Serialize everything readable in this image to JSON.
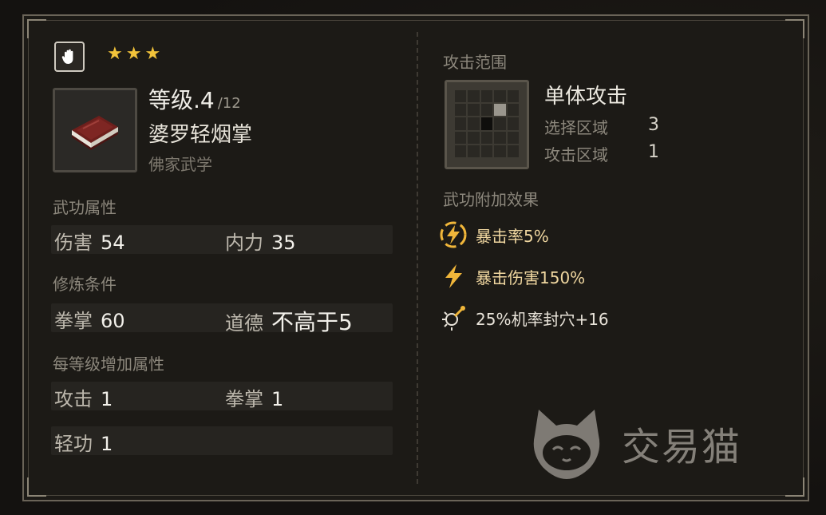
{
  "skill": {
    "stars": 3,
    "level_text": "等级.4",
    "max_level_text": "/12",
    "name": "婆罗轻烟掌",
    "school": "佛家武学"
  },
  "attributes": {
    "label": "武功属性",
    "damage_key": "伤害",
    "damage_value": "54",
    "inner_key": "内力",
    "inner_value": "35"
  },
  "requirements": {
    "label": "修炼条件",
    "fist_key": "拳掌",
    "fist_value": "60",
    "morality_key": "道德",
    "morality_value": "不高于5"
  },
  "per_level": {
    "label": "每等级增加属性",
    "attack_key": "攻击",
    "attack_value": "1",
    "fist_key": "拳掌",
    "fist_value": "1",
    "lightness_key": "轻功",
    "lightness_value": "1"
  },
  "range": {
    "label": "攻击范围",
    "type": "单体攻击",
    "select_key": "选择区域",
    "select_value": "3",
    "attack_key": "攻击区域",
    "attack_value": "1"
  },
  "effects": {
    "label": "武功附加效果",
    "items": [
      {
        "icon": "lightning-circle-icon",
        "text": "暴击率5%"
      },
      {
        "icon": "lightning-icon",
        "text": "暴击伤害150%"
      },
      {
        "icon": "acupoint-pin-icon",
        "text": "25%机率封穴+16"
      }
    ]
  },
  "watermark": "交易猫",
  "colors": {
    "star": "#f2c33a",
    "effect_text": "#f0d7a0",
    "effect_icon": "#f0b63a"
  }
}
